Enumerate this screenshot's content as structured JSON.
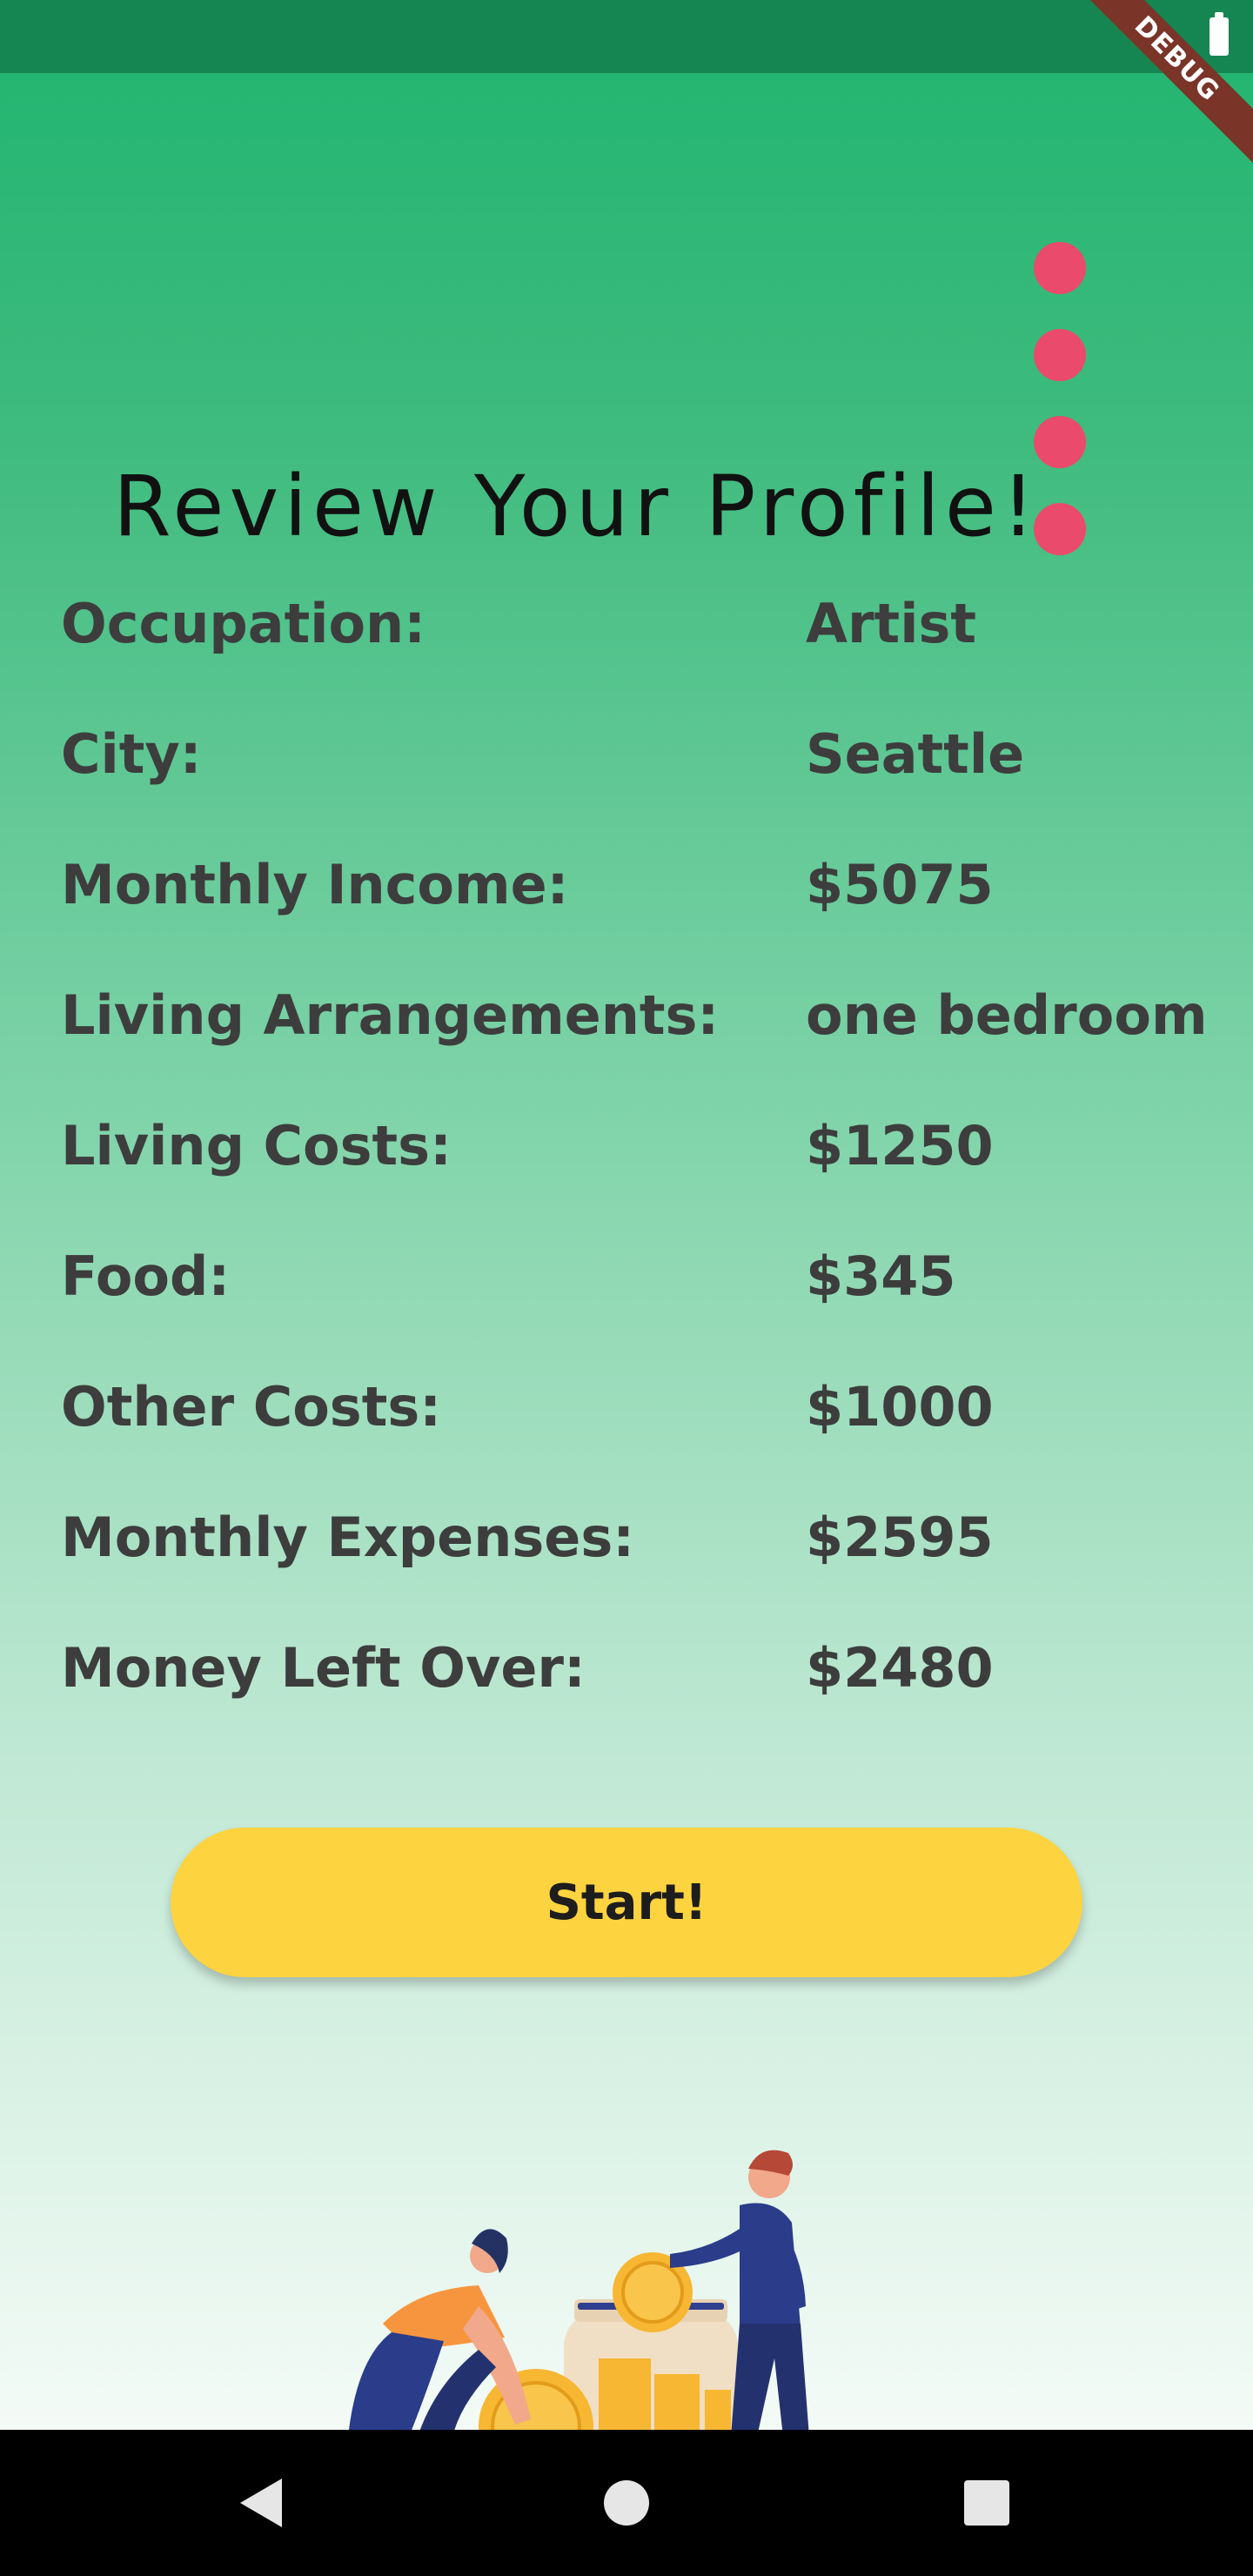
{
  "status_bar": {
    "icons": [
      "battery-icon"
    ]
  },
  "debug_banner": "DEBUG",
  "menu": {
    "icon": "vertical-dots-icon",
    "color": "#ea4a6b"
  },
  "title": "Review Your Profile!",
  "profile": {
    "rows": [
      {
        "label": "Occupation:",
        "value": "Artist"
      },
      {
        "label": "City:",
        "value": "Seattle"
      },
      {
        "label": "Monthly Income:",
        "value": "$5075"
      },
      {
        "label": "Living Arrangements:",
        "value": "one bedroom"
      },
      {
        "label": "Living Costs:",
        "value": "$1250"
      },
      {
        "label": "Food:",
        "value": "$345"
      },
      {
        "label": "Other Costs:",
        "value": "$1000"
      },
      {
        "label": "Monthly Expenses:",
        "value": "$2595"
      },
      {
        "label": "Money Left Over:",
        "value": "$2480"
      }
    ]
  },
  "start_button": {
    "label": "Start!",
    "color": "#fdd33f"
  },
  "illustration": {
    "name": "people-saving-coins-illustration"
  },
  "nav_bar": {
    "icons": [
      "back-icon",
      "home-icon",
      "recents-icon"
    ]
  },
  "colors": {
    "gradient_top": "#1fb46f",
    "gradient_bottom": "#f4fbf7",
    "text": "#3d3d3d"
  }
}
